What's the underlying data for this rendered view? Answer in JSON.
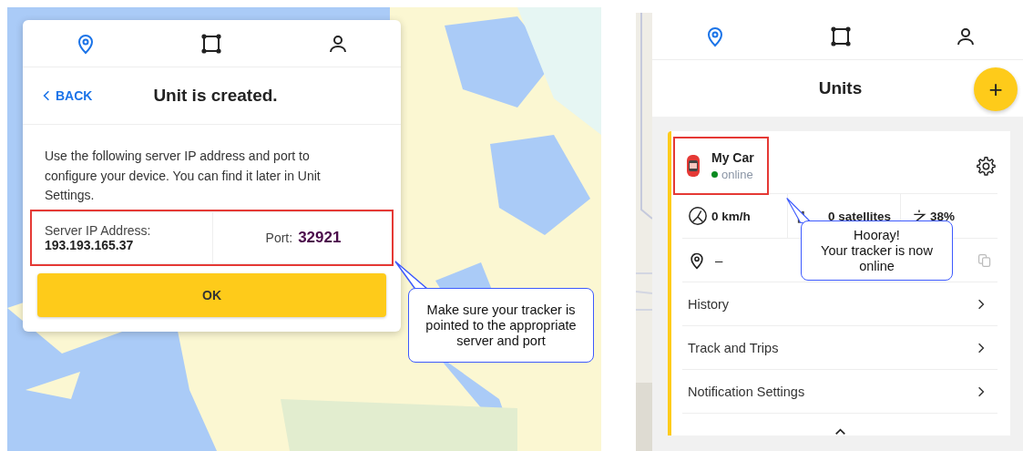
{
  "left_screen": {
    "nav_tabs": [
      {
        "kind": "pin",
        "selected": true
      },
      {
        "kind": "area",
        "selected": false
      },
      {
        "kind": "user",
        "selected": false
      }
    ],
    "back_link": "BACK",
    "title": "Unit is created.",
    "message": "Use the following server IP address and port to configure your device. You can find it later in Unit Settings.",
    "server_info": {
      "highlighted": true,
      "ip_label": "Server IP Address:",
      "ip": "193.193.165.37",
      "port_label": "Port:",
      "port": "32921"
    },
    "ok_button": "OK",
    "callout": "Make sure your tracker is pointed to the appropriate server and port"
  },
  "right_screen": {
    "nav_tabs": [
      {
        "kind": "pin",
        "selected": true
      },
      {
        "kind": "area",
        "selected": false
      },
      {
        "kind": "user",
        "selected": false
      }
    ],
    "title": "Units",
    "add_button": "+",
    "unit": {
      "highlighted": true,
      "name": "My Car",
      "status": "online",
      "online": true,
      "speed": "0 km/h",
      "satellites": "0 satellites",
      "battery": "38%",
      "location": "–"
    },
    "menu_items": [
      "History",
      "Track and Trips",
      "Notification Settings"
    ],
    "callout": "Hooray!\nYour tracker is now online"
  }
}
